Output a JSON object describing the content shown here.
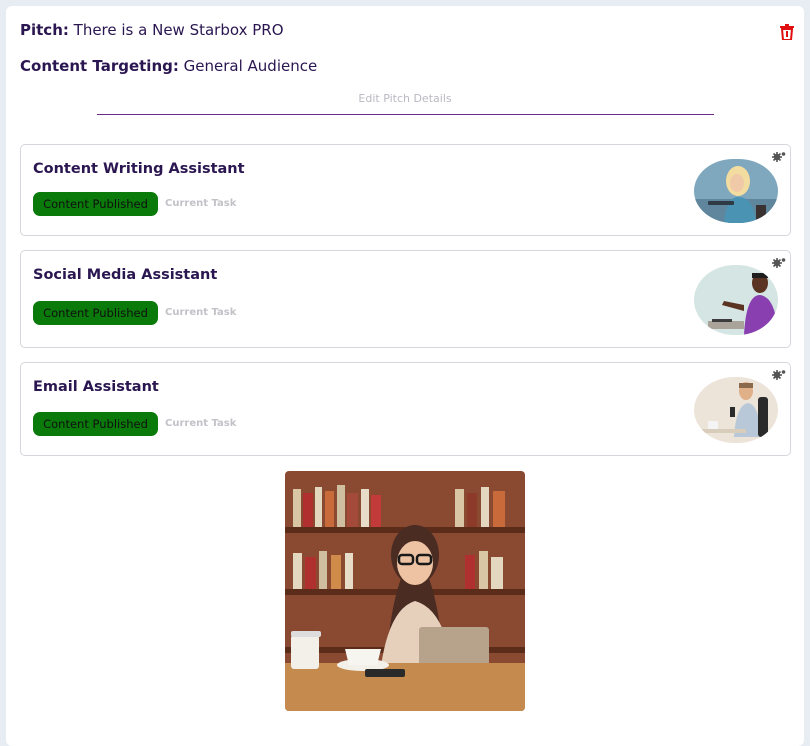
{
  "pitch": {
    "label": "Pitch:",
    "value": "There is a New Starbox PRO",
    "targeting_label": "Content Targeting:",
    "targeting_value": "General Audience",
    "edit_link": "Edit Pitch Details"
  },
  "assistants": [
    {
      "name": "Content Writing Assistant",
      "status": "Content Published",
      "task_label": "Current Task",
      "avatar_icon": "woman-laptop-avatar"
    },
    {
      "name": "Social Media Assistant",
      "status": "Content Published",
      "task_label": "Current Task",
      "avatar_icon": "man-presenting-avatar"
    },
    {
      "name": "Email Assistant",
      "status": "Content Published",
      "task_label": "Current Task",
      "avatar_icon": "man-desk-avatar"
    }
  ],
  "colors": {
    "accent": "#2a1650",
    "status_bg": "#0a7a0a",
    "delete": "#e01010",
    "divider": "#6b2a8a"
  }
}
